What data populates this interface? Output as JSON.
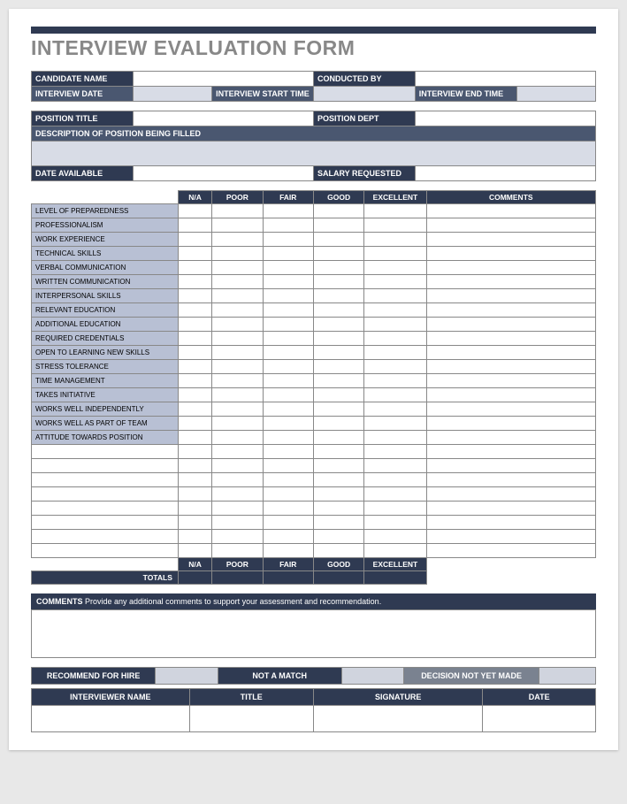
{
  "title": "INTERVIEW EVALUATION FORM",
  "header": {
    "candidate_name": "CANDIDATE NAME",
    "conducted_by": "CONDUCTED BY",
    "interview_date": "INTERVIEW DATE",
    "interview_start_time": "INTERVIEW START TIME",
    "interview_end_time": "INTERVIEW END TIME",
    "position_title": "POSITION TITLE",
    "position_dept": "POSITION DEPT",
    "description": "DESCRIPTION OF POSITION BEING FILLED",
    "date_available": "DATE AVAILABLE",
    "salary_requested": "SALARY REQUESTED"
  },
  "cols": {
    "na": "N/A",
    "poor": "POOR",
    "fair": "FAIR",
    "good": "GOOD",
    "excellent": "EXCELLENT",
    "comments": "COMMENTS"
  },
  "criteria": [
    "LEVEL OF PREPAREDNESS",
    "PROFESSIONALISM",
    "WORK EXPERIENCE",
    "TECHNICAL SKILLS",
    "VERBAL COMMUNICATION",
    "WRITTEN COMMUNICATION",
    "INTERPERSONAL SKILLS",
    "RELEVANT EDUCATION",
    "ADDITIONAL EDUCATION",
    "REQUIRED CREDENTIALS",
    "OPEN TO LEARNING NEW SKILLS",
    "STRESS TOLERANCE",
    "TIME MANAGEMENT",
    "TAKES INITIATIVE",
    "WORKS WELL INDEPENDENTLY",
    "WORKS WELL AS PART OF TEAM",
    "ATTITUDE TOWARDS POSITION"
  ],
  "totals_label": "TOTALS",
  "comments": {
    "label": "COMMENTS",
    "text": "Provide any additional comments to support your assessment and recommendation."
  },
  "recommend": {
    "for_hire": "RECOMMEND FOR HIRE",
    "not_match": "NOT A MATCH",
    "not_yet": "DECISION NOT YET MADE"
  },
  "signature": {
    "interviewer": "INTERVIEWER NAME",
    "title": "TITLE",
    "signature": "SIGNATURE",
    "date": "DATE"
  }
}
